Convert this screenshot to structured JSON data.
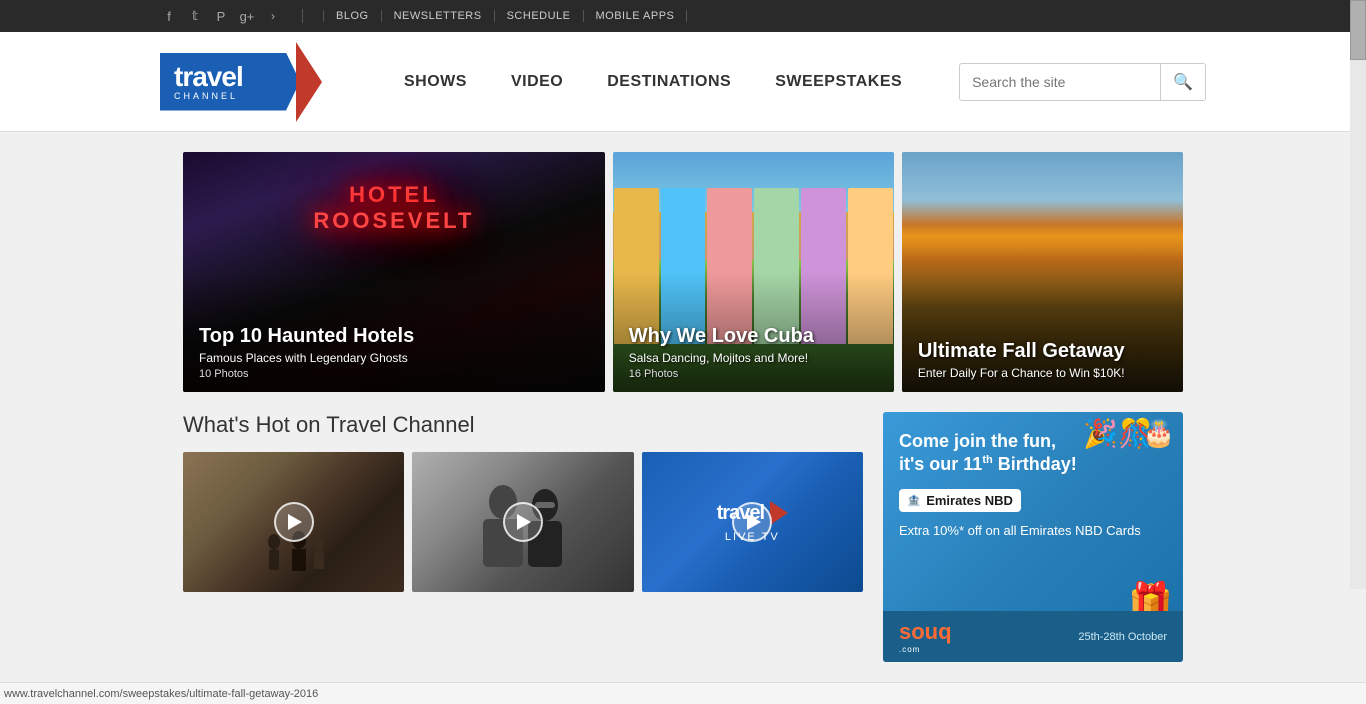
{
  "topbar": {
    "social_icons": [
      {
        "name": "facebook-icon",
        "symbol": "f"
      },
      {
        "name": "twitter-icon",
        "symbol": "t"
      },
      {
        "name": "pinterest-icon",
        "symbol": "p"
      },
      {
        "name": "googleplus-icon",
        "symbol": "g+"
      },
      {
        "name": "more-icon",
        "symbol": "›"
      }
    ],
    "links": [
      {
        "name": "blog-link",
        "label": "BLOG"
      },
      {
        "name": "newsletters-link",
        "label": "NEWSLETTERS"
      },
      {
        "name": "schedule-link",
        "label": "SCHEDULE"
      },
      {
        "name": "mobile-apps-link",
        "label": "MOBILE APPS"
      }
    ]
  },
  "header": {
    "logo": {
      "travel": "travel",
      "channel": "CHANNEL"
    },
    "nav": [
      {
        "name": "shows-nav",
        "label": "SHOWS"
      },
      {
        "name": "video-nav",
        "label": "VIDEO"
      },
      {
        "name": "destinations-nav",
        "label": "DESTINATIONS"
      },
      {
        "name": "sweepstakes-nav",
        "label": "SWEEPSTAKES"
      }
    ],
    "search": {
      "placeholder": "Search the site",
      "icon": "🔍"
    }
  },
  "hero": {
    "cards": [
      {
        "name": "haunted-hotels-card",
        "title": "Top 10 Haunted Hotels",
        "subtitle": "Famous Places with Legendary Ghosts",
        "count": "10 Photos",
        "bg_type": "haunted"
      },
      {
        "name": "cuba-card",
        "title": "Why We Love Cuba",
        "subtitle": "Salsa Dancing, Mojitos and More!",
        "count": "16 Photos",
        "bg_type": "cuba"
      },
      {
        "name": "fall-getaway-card",
        "title": "Ultimate Fall Getaway",
        "subtitle": "Enter Daily For a Chance to Win $10K!",
        "count": "",
        "bg_type": "fall"
      }
    ]
  },
  "whats_hot": {
    "title": "What's Hot on Travel Channel",
    "videos": [
      {
        "name": "video-thumb-1",
        "bg": "outdoor"
      },
      {
        "name": "video-thumb-2",
        "bg": "people"
      },
      {
        "name": "video-thumb-3",
        "bg": "livetv",
        "label": "Live TV",
        "is_live": true
      }
    ]
  },
  "ad": {
    "title_line1": "Come join the fun,",
    "title_line2": "it's our 11",
    "title_sup": "th",
    "title_line3": " Birthday!",
    "bank_name": "Emirates NBD",
    "offer": "Extra 10%* off on all Emirates NBD Cards",
    "souq": "souq",
    "date": "25th-28th October"
  },
  "status": {
    "url": "www.travelchannel.com/sweepstakes/ultimate-fall-getaway-2016"
  }
}
